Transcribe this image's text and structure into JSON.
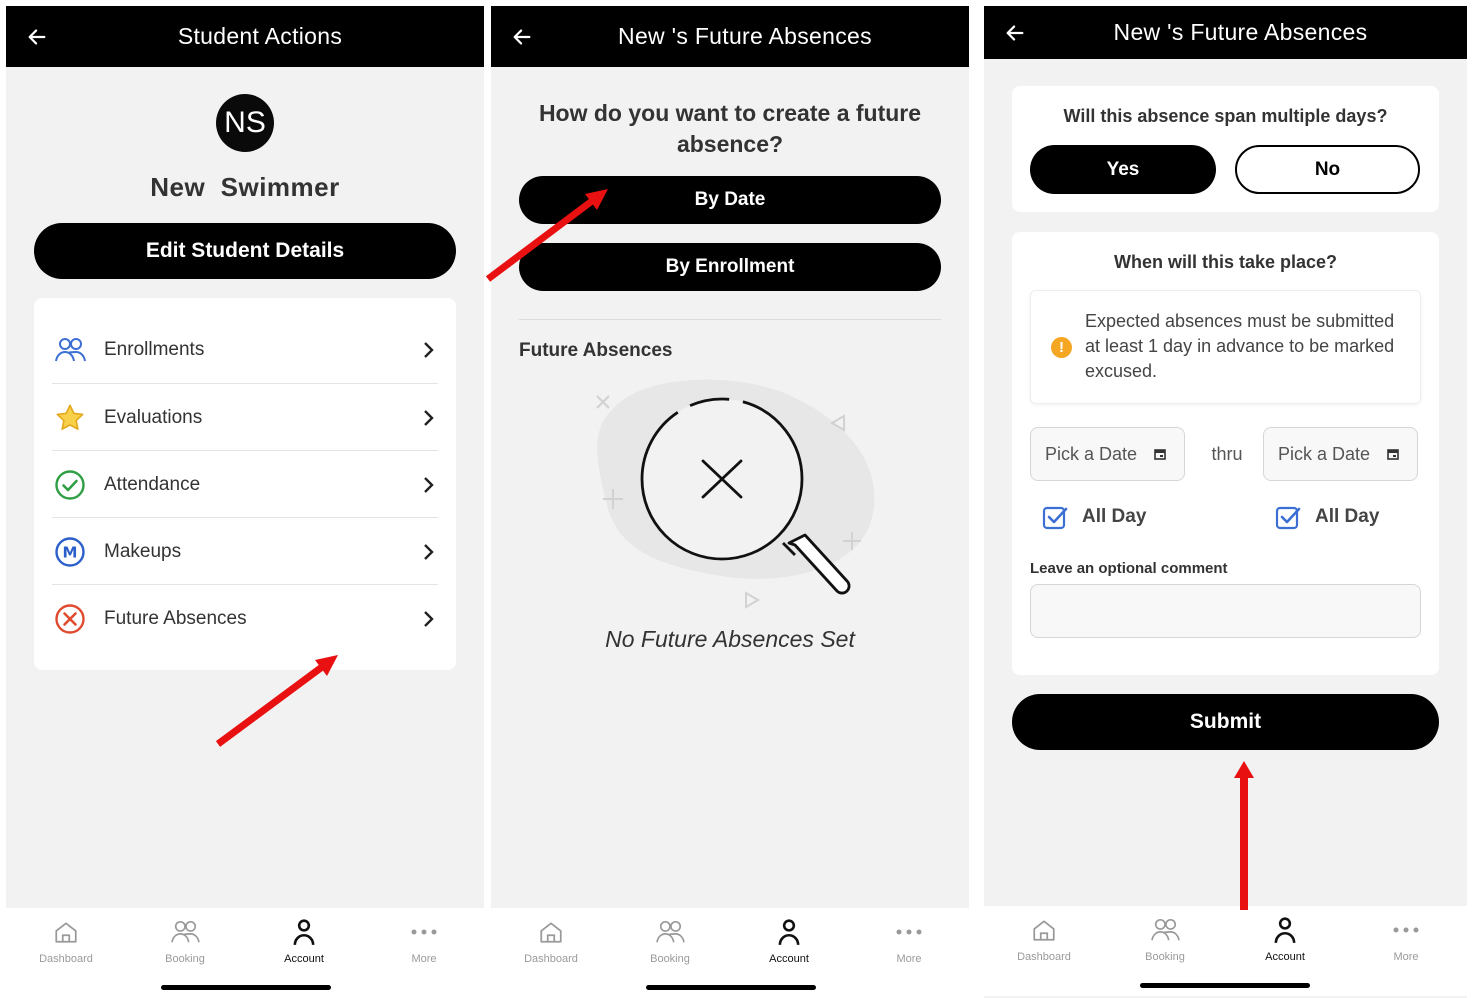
{
  "panel1": {
    "header": {
      "title": "Student Actions",
      "back_icon": "back-arrow-icon"
    },
    "avatar_initials": "NS",
    "student_name": "New  Swimmer",
    "edit_button": "Edit Student Details",
    "menu": [
      {
        "label": "Enrollments",
        "icon": "people-icon",
        "color": "#3b6fd4"
      },
      {
        "label": "Evaluations",
        "icon": "star-icon",
        "color": "#f3c12b"
      },
      {
        "label": "Attendance",
        "icon": "check-circle-icon",
        "color": "#2f9e44"
      },
      {
        "label": "Makeups",
        "icon": "m-circle-icon",
        "color": "#2b5fc9"
      },
      {
        "label": "Future Absences",
        "icon": "x-circle-icon",
        "color": "#e04a2f"
      }
    ]
  },
  "panel2": {
    "header": {
      "title": "New 's Future Absences"
    },
    "question": "How do you want to create a future absence?",
    "by_date": "By Date",
    "by_enrollment": "By Enrollment",
    "section_title": "Future Absences",
    "empty_text": "No Future Absences Set"
  },
  "panel3": {
    "header": {
      "title": "New 's Future Absences"
    },
    "multi_day_question": "Will this absence span multiple days?",
    "yes": "Yes",
    "no": "No",
    "when_question": "When will this take place?",
    "info_icon_glyph": "!",
    "info_text": "Expected absences must be submitted at least 1 day in advance to be marked excused.",
    "start_date_placeholder": "Pick a Date",
    "thru": "thru",
    "end_date_placeholder": "Pick a Date",
    "all_day_start": "All Day",
    "all_day_end": "All Day",
    "comment_label": "Leave an optional comment",
    "comment_value": "",
    "submit": "Submit"
  },
  "tabbar": [
    {
      "label": "Dashboard",
      "icon": "home-icon"
    },
    {
      "label": "Booking",
      "icon": "people-icon"
    },
    {
      "label": "Account",
      "icon": "person-icon",
      "active": true
    },
    {
      "label": "More",
      "icon": "more-dots-icon"
    }
  ],
  "colors": {
    "header_bg": "#000000",
    "screen_bg": "#f2f2f2",
    "annotation_arrow": "#e81010",
    "info": "#f5a623",
    "checkbox": "#3b6fd4"
  }
}
